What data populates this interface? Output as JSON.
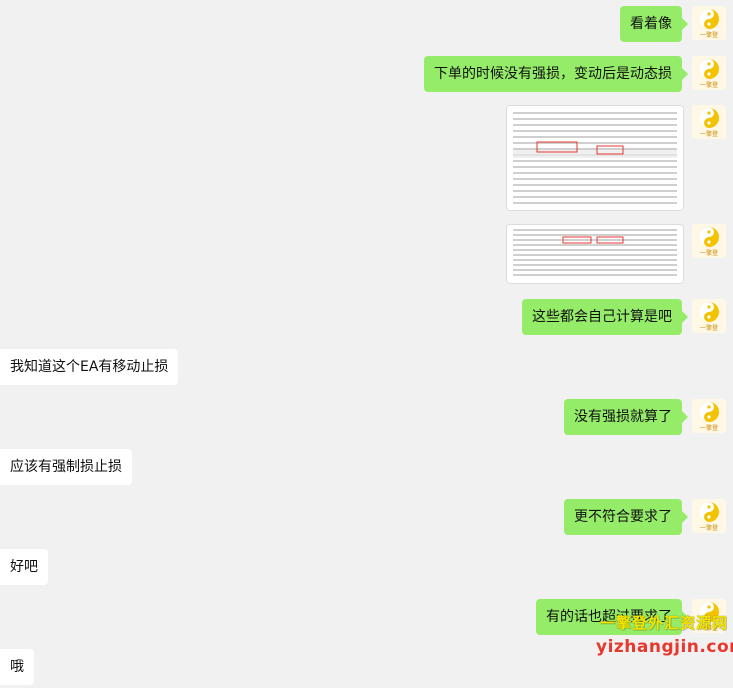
{
  "messages": {
    "m1": {
      "text": "看着像"
    },
    "m2": {
      "text": "下单的时候没有强损，变动后是动态损"
    },
    "m3": {
      "type": "image",
      "description": "spreadsheet-screenshot"
    },
    "m4": {
      "type": "image",
      "description": "spreadsheet-screenshot"
    },
    "m5": {
      "text": "这些都会自己计算是吧"
    },
    "m6": {
      "text": "我知道这个EA有移动止损"
    },
    "m7": {
      "text": "没有强损就算了"
    },
    "m8": {
      "text": "应该有强制损止损"
    },
    "m9": {
      "text": "更不符合要求了"
    },
    "m10": {
      "text": "好吧"
    },
    "m11": {
      "text": "有的话也超过要求了"
    },
    "m12": {
      "text": "哦"
    }
  },
  "avatar": {
    "label": "一擎登",
    "icon": "yin-yang-logo-icon"
  },
  "watermark": {
    "line1": "一擎登外汇资源网",
    "line2": "yizhangjin.com"
  },
  "colors": {
    "outgoing_bubble": "#95ec69",
    "incoming_bubble": "#ffffff",
    "background": "#f1f1f1"
  }
}
